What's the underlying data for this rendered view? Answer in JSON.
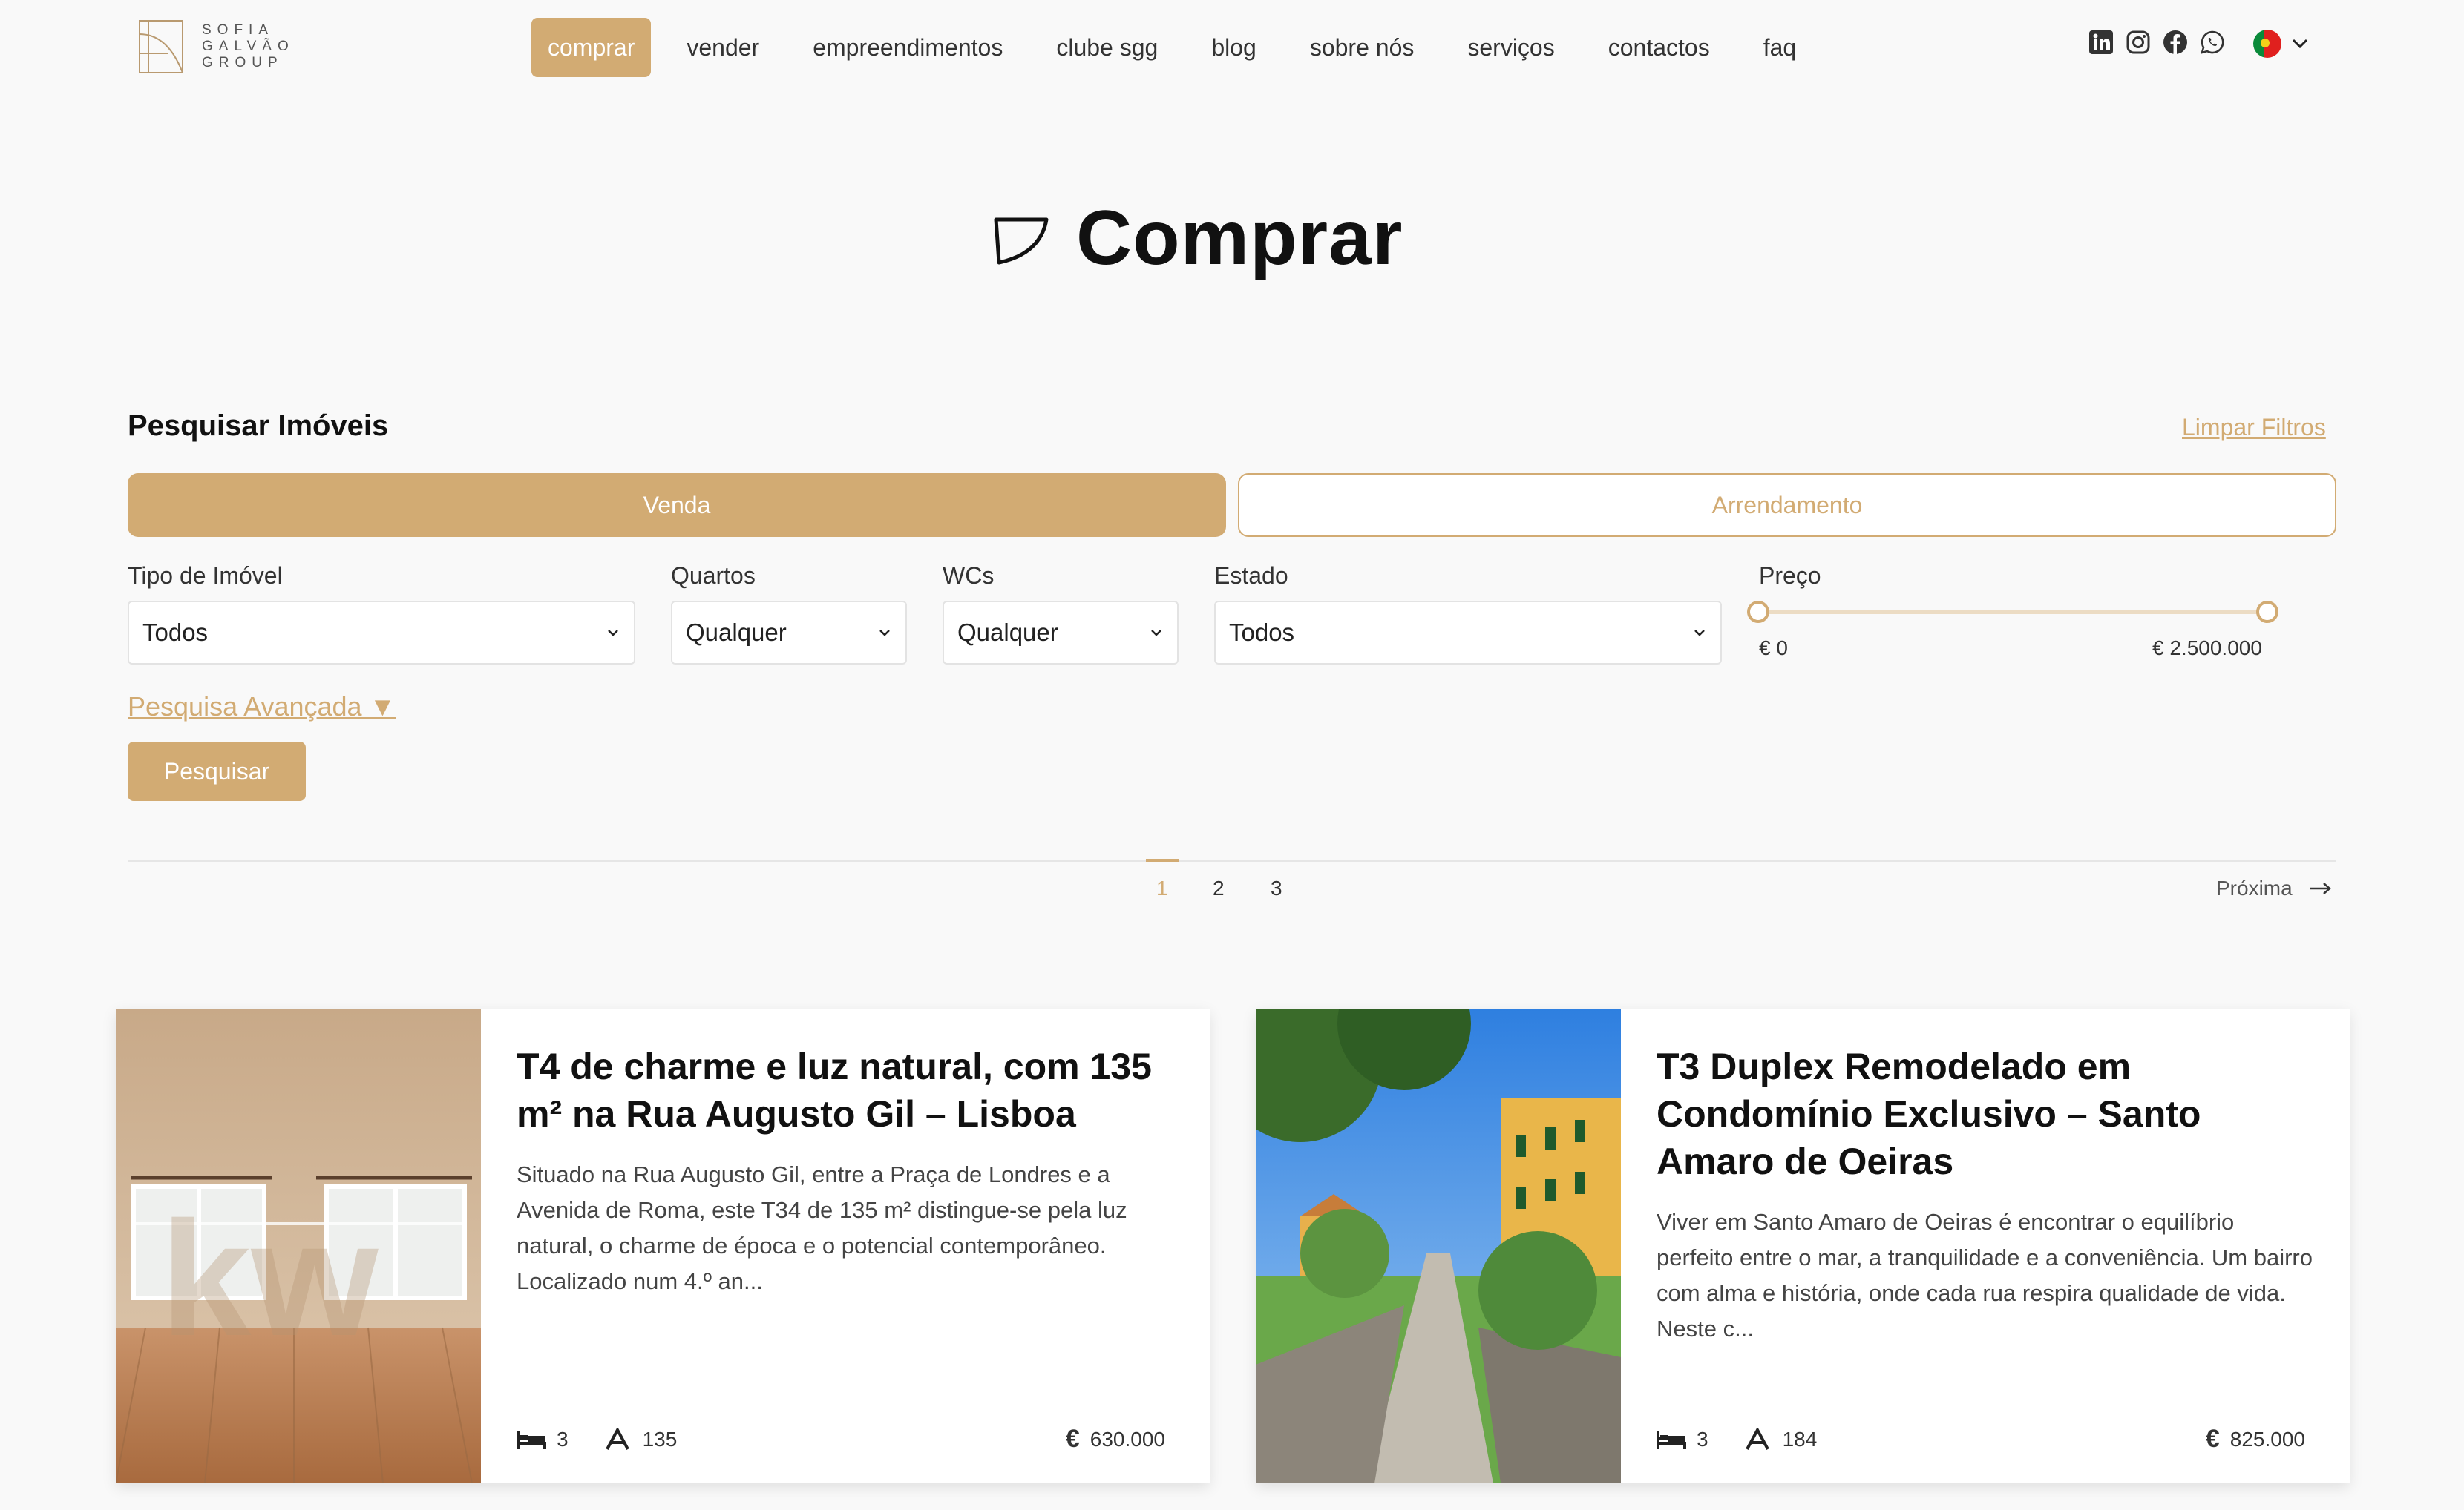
{
  "brand": {
    "name_lines": [
      "SOFIA",
      "GALVÃO",
      "GROUP"
    ],
    "accent": "#d2ab73"
  },
  "nav": {
    "items": [
      {
        "label": "comprar",
        "active": true
      },
      {
        "label": "vender"
      },
      {
        "label": "empreendimentos"
      },
      {
        "label": "clube sgg"
      },
      {
        "label": "blog"
      },
      {
        "label": "sobre nós"
      },
      {
        "label": "serviços"
      },
      {
        "label": "contactos"
      },
      {
        "label": "faq"
      }
    ],
    "socials": [
      "linkedin-icon",
      "instagram-icon",
      "facebook-icon",
      "whatsapp-icon"
    ],
    "language": "portugal-flag-icon"
  },
  "page": {
    "title": "Comprar"
  },
  "search": {
    "heading": "Pesquisar Imóveis",
    "clear": "Limpar Filtros",
    "tabs": [
      "Venda",
      "Arrendamento"
    ],
    "fields": {
      "type": {
        "label": "Tipo de Imóvel",
        "value": "Todos"
      },
      "rooms": {
        "label": "Quartos",
        "value": "Qualquer"
      },
      "wcs": {
        "label": "WCs",
        "value": "Qualquer"
      },
      "state": {
        "label": "Estado",
        "value": "Todos"
      },
      "price": {
        "label": "Preço",
        "min": "€ 0",
        "max": "€ 2.500.000"
      }
    },
    "advanced": "Pesquisa Avançada ▼",
    "submit": "Pesquisar"
  },
  "pagination": {
    "pages": [
      "1",
      "2",
      "3"
    ],
    "current": "1",
    "next": "Próxima"
  },
  "listings": [
    {
      "title": "T4 de charme e luz natural, com 135 m² na Rua Augusto Gil – Lisboa",
      "description": "Situado na Rua Augusto Gil, entre a Praça de Londres e a Avenida de Roma, este T34 de 135 m² distingue-se pela luz natural, o charme de época e o potencial contemporâneo. Localizado num 4.º an...",
      "bedrooms": "3",
      "area": "135",
      "price": "630.000"
    },
    {
      "title": "T3 Duplex Remodelado em Condomínio Exclusivo – Santo Amaro de Oeiras",
      "description": "Viver em Santo Amaro de Oeiras é encontrar o equilíbrio perfeito entre o mar, a tranquilidade e a conveniência. Um bairro com alma e história, onde cada rua respira qualidade de vida. Neste c...",
      "bedrooms": "3",
      "area": "184",
      "price": "825.000"
    }
  ]
}
